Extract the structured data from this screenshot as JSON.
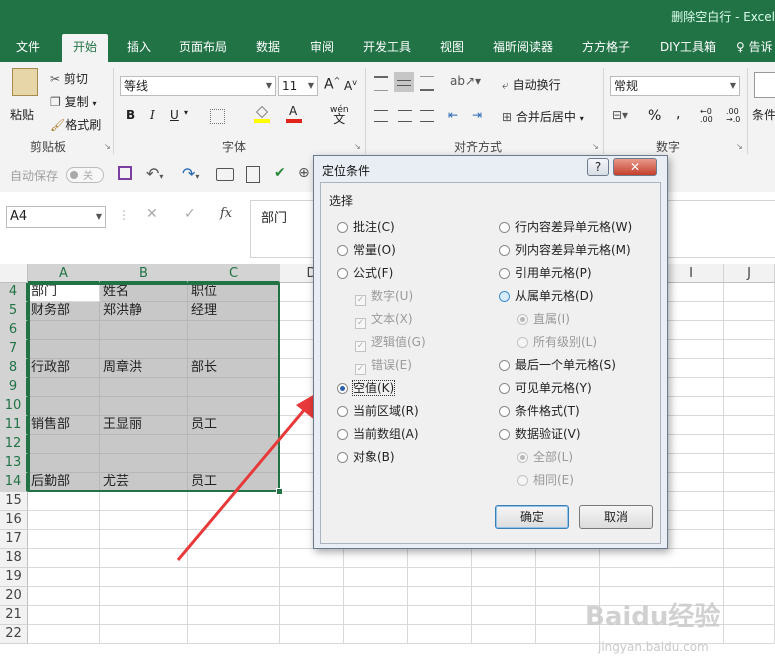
{
  "window": {
    "title": "删除空白行 - Excel"
  },
  "tabs": [
    "文件",
    "开始",
    "插入",
    "页面布局",
    "数据",
    "审阅",
    "开发工具",
    "视图",
    "福昕阅读器",
    "方方格子",
    "DIY工具箱",
    "♀ 告诉"
  ],
  "active_tab": "开始",
  "ribbon": {
    "clipboard": {
      "paste": "粘贴",
      "cut": "剪切",
      "copy": "复制",
      "format_painter": "格式刷",
      "label": "剪贴板"
    },
    "font": {
      "font_name": "等线",
      "font_size": "11",
      "bold": "B",
      "italic": "I",
      "underline": "U",
      "grow": "A",
      "shrink": "A",
      "wen": "wén",
      "label": "字体"
    },
    "alignment": {
      "wrap": "自动换行",
      "merge": "合并后居中",
      "label": "对齐方式"
    },
    "number": {
      "format": "常规",
      "percent": "%",
      "comma": ",",
      "label": "数字"
    },
    "styles": {
      "cond_format": "条件"
    }
  },
  "qat": {
    "autosave_label": "自动保存",
    "autosave_state": "关"
  },
  "formula_bar": {
    "name_box": "A4",
    "fx": "fx",
    "content": "部门"
  },
  "grid": {
    "columns": [
      "A",
      "B",
      "C",
      "D",
      "E",
      "F",
      "G",
      "H",
      "I",
      "J"
    ],
    "rows": [
      "4",
      "5",
      "6",
      "7",
      "8",
      "9",
      "10",
      "11",
      "12",
      "13",
      "14",
      "15",
      "16",
      "17",
      "18",
      "19",
      "20",
      "21",
      "22"
    ],
    "cells": [
      [
        "部门",
        "姓名",
        "职位"
      ],
      [
        "财务部",
        "郑洪静",
        "经理"
      ],
      [
        "",
        "",
        ""
      ],
      [
        "",
        "",
        ""
      ],
      [
        "行政部",
        "周章洪",
        "部长"
      ],
      [
        "",
        "",
        ""
      ],
      [
        "",
        "",
        ""
      ],
      [
        "销售部",
        "王显丽",
        "员工"
      ],
      [
        "",
        "",
        ""
      ],
      [
        "",
        "",
        ""
      ],
      [
        "后勤部",
        "尤芸",
        "员工"
      ]
    ]
  },
  "dialog": {
    "title": "定位条件",
    "help": "?",
    "close": "✕",
    "group_label": "选择",
    "left_options": [
      {
        "label": "批注(C)",
        "state": "normal"
      },
      {
        "label": "常量(O)",
        "state": "normal"
      },
      {
        "label": "公式(F)",
        "state": "normal"
      },
      {
        "label": "数字(U)",
        "state": "sub-check"
      },
      {
        "label": "文本(X)",
        "state": "sub-check"
      },
      {
        "label": "逻辑值(G)",
        "state": "sub-check"
      },
      {
        "label": "错误(E)",
        "state": "sub-check"
      },
      {
        "label": "空值(K)",
        "state": "selected"
      },
      {
        "label": "当前区域(R)",
        "state": "normal"
      },
      {
        "label": "当前数组(A)",
        "state": "normal"
      },
      {
        "label": "对象(B)",
        "state": "normal"
      }
    ],
    "right_options": [
      {
        "label": "行内容差异单元格(W)",
        "state": "normal"
      },
      {
        "label": "列内容差异单元格(M)",
        "state": "normal"
      },
      {
        "label": "引用单元格(P)",
        "state": "normal"
      },
      {
        "label": "从属单元格(D)",
        "state": "hot"
      },
      {
        "label": "直属(I)",
        "state": "sub-radio-on"
      },
      {
        "label": "所有级别(L)",
        "state": "sub-radio"
      },
      {
        "label": "最后一个单元格(S)",
        "state": "normal"
      },
      {
        "label": "可见单元格(Y)",
        "state": "normal"
      },
      {
        "label": "条件格式(T)",
        "state": "normal"
      },
      {
        "label": "数据验证(V)",
        "state": "normal"
      },
      {
        "label": "全部(L)",
        "state": "sub-radio-on"
      },
      {
        "label": "相同(E)",
        "state": "sub-radio"
      }
    ],
    "ok": "确定",
    "cancel": "取消"
  },
  "watermark": {
    "text": "Baidu经验",
    "sub": "jingyan.baidu.com"
  },
  "colors": {
    "excel_green": "#217346",
    "selection_gray": "#c8c8c8",
    "arrow_red": "#e8393a"
  }
}
